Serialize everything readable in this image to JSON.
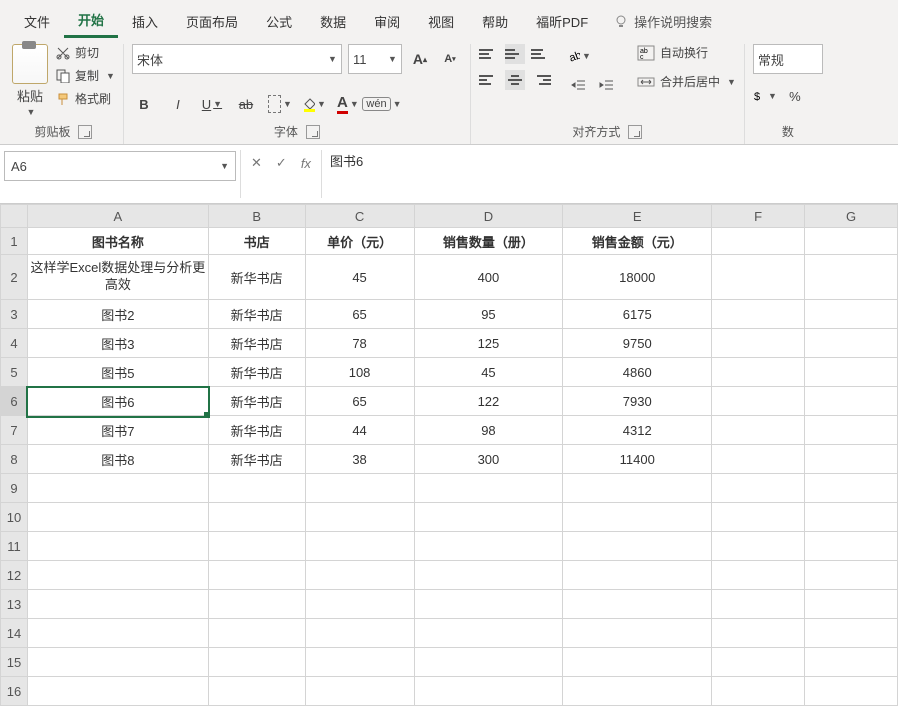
{
  "tabs": [
    "文件",
    "开始",
    "插入",
    "页面布局",
    "公式",
    "数据",
    "审阅",
    "视图",
    "帮助",
    "福昕PDF"
  ],
  "active_tab": "开始",
  "help_search": "操作说明搜索",
  "clipboard": {
    "paste": "粘贴",
    "cut": "剪切",
    "copy": "复制",
    "format_painter": "格式刷",
    "group": "剪贴板"
  },
  "font": {
    "name": "宋体",
    "size": "11",
    "group": "字体"
  },
  "align": {
    "wrap": "自动换行",
    "merge": "合并后居中",
    "group": "对齐方式"
  },
  "number": {
    "format": "常规",
    "percent": "%",
    "group": "数"
  },
  "namebox": "A6",
  "formula": "图书6",
  "columns": [
    "A",
    "B",
    "C",
    "D",
    "E",
    "F",
    "G"
  ],
  "headers": [
    "图书名称",
    "书店",
    "单价（元）",
    "销售数量（册）",
    "销售金额（元）"
  ],
  "rows": [
    {
      "n": 1
    },
    {
      "n": 2,
      "a": "这样学Excel数据处理与分析更高效",
      "b": "新华书店",
      "c": "45",
      "d": "400",
      "e": "18000",
      "tall": true,
      "yellow": true
    },
    {
      "n": 3,
      "a": "图书2",
      "b": "新华书店",
      "c": "65",
      "d": "95",
      "e": "6175"
    },
    {
      "n": 4,
      "a": "图书3",
      "b": "新华书店",
      "c": "78",
      "d": "125",
      "e": "9750"
    },
    {
      "n": 5,
      "a": "图书5",
      "b": "新华书店",
      "c": "108",
      "d": "45",
      "e": "4860"
    },
    {
      "n": 6,
      "a": "图书6",
      "b": "新华书店",
      "c": "65",
      "d": "122",
      "e": "7930",
      "sel": true
    },
    {
      "n": 7,
      "a": "图书7",
      "b": "新华书店",
      "c": "44",
      "d": "98",
      "e": "4312"
    },
    {
      "n": 8,
      "a": "图书8",
      "b": "新华书店",
      "c": "38",
      "d": "300",
      "e": "11400"
    },
    {
      "n": 9
    },
    {
      "n": 10
    },
    {
      "n": 11
    },
    {
      "n": 12
    },
    {
      "n": 13
    },
    {
      "n": 14
    },
    {
      "n": 15
    },
    {
      "n": 16
    }
  ],
  "chart_data": {
    "type": "table",
    "headers": [
      "图书名称",
      "书店",
      "单价（元）",
      "销售数量（册）",
      "销售金额（元）"
    ],
    "rows": [
      [
        "这样学Excel数据处理与分析更高效",
        "新华书店",
        45,
        400,
        18000
      ],
      [
        "图书2",
        "新华书店",
        65,
        95,
        6175
      ],
      [
        "图书3",
        "新华书店",
        78,
        125,
        9750
      ],
      [
        "图书5",
        "新华书店",
        108,
        45,
        4860
      ],
      [
        "图书6",
        "新华书店",
        65,
        122,
        7930
      ],
      [
        "图书7",
        "新华书店",
        44,
        98,
        4312
      ],
      [
        "图书8",
        "新华书店",
        38,
        300,
        11400
      ]
    ]
  }
}
